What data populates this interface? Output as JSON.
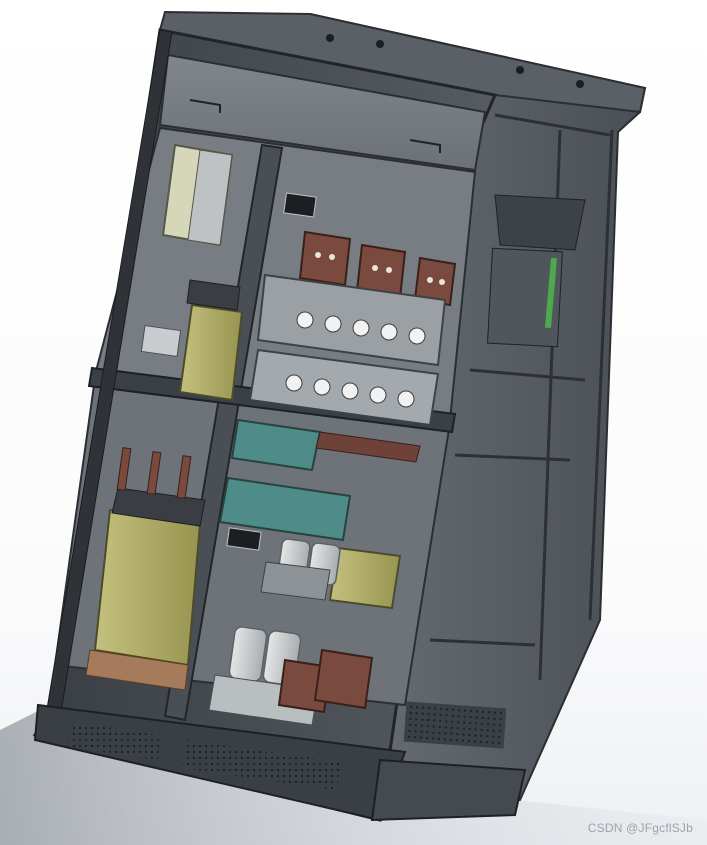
{
  "watermark": {
    "text": "CSDN @JFgcflSJb"
  },
  "colors": {
    "frame": "#4a4f55",
    "frame_dark": "#2f3338",
    "panel_grey": "#8a9095",
    "transformer": "#b7b572",
    "busbar": "#7a4a3e",
    "teal_board": "#4f8b88",
    "capacitor": "#cfd3d4"
  }
}
